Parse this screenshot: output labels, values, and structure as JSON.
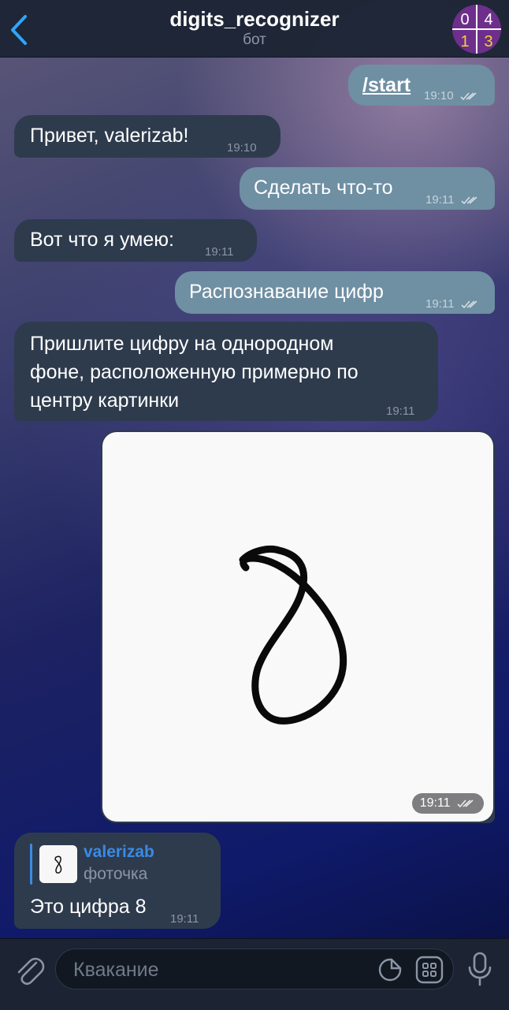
{
  "header": {
    "title": "digits_recognizer",
    "subtitle": "бот",
    "avatar_digits": [
      "0",
      "4",
      "1",
      "3"
    ]
  },
  "messages": [
    {
      "side": "out",
      "text": "/start",
      "time": "19:10"
    },
    {
      "side": "in",
      "text": "Привет, valerizab!",
      "time": "19:10"
    },
    {
      "side": "out",
      "text": "Сделать что-то",
      "time": "19:11"
    },
    {
      "side": "in",
      "text": "Вот что я умею:",
      "time": "19:11"
    },
    {
      "side": "out",
      "text": "Распознавание цифр",
      "time": "19:11"
    },
    {
      "side": "in",
      "lines": [
        "Пришлите цифру на однородном",
        "фоне, расположенную примерно по",
        "центру картинки"
      ],
      "time": "19:11"
    },
    {
      "side": "out",
      "type": "photo",
      "time": "19:11"
    },
    {
      "side": "in",
      "reply_name": "valerizab",
      "reply_text": "фоточка",
      "text": "Это цифра 8",
      "time": "19:11"
    }
  ],
  "composer": {
    "placeholder": "Квакание"
  },
  "colors": {
    "outgoing_bubble": "#6f8fa3",
    "incoming_bubble": "#2e3b4d",
    "accent": "#3a8ae6",
    "header_bg": "#1c2434"
  },
  "icons": [
    "back-chevron-icon",
    "double-check-icon",
    "paperclip-icon",
    "sticker-icon",
    "bot-commands-icon",
    "microphone-icon"
  ]
}
